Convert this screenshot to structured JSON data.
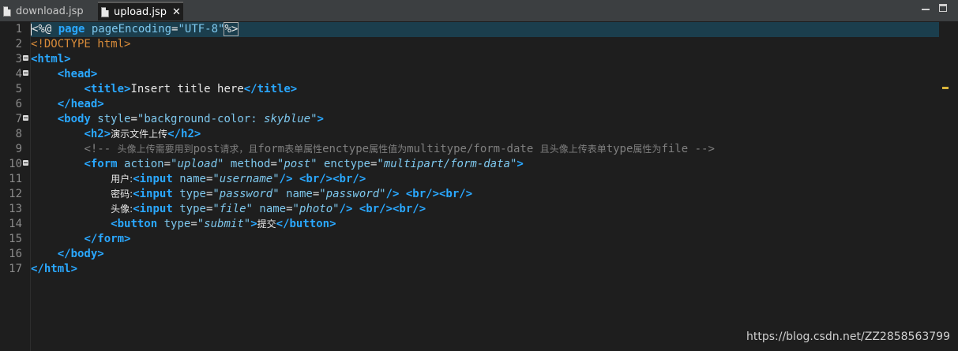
{
  "tabs": [
    {
      "label": "download.jsp",
      "active": false
    },
    {
      "label": "upload.jsp",
      "active": true
    }
  ],
  "close_glyph": "✕",
  "line_numbers": [
    "1",
    "2",
    "3",
    "4",
    "5",
    "6",
    "7",
    "8",
    "9",
    "10",
    "11",
    "12",
    "13",
    "14",
    "15",
    "16",
    "17"
  ],
  "code": {
    "l1": {
      "open": "<%@ ",
      "kw": "page",
      "attr": "pageEncoding",
      "eq": "=",
      "val": "\"UTF-8\"",
      "close": "%>"
    },
    "l2": {
      "text": "<!DOCTYPE html>"
    },
    "l3": {
      "tag": "<html>"
    },
    "l4": {
      "tag": "<head>"
    },
    "l5": {
      "open": "<title>",
      "text": "Insert title here",
      "close": "</title>"
    },
    "l6": {
      "tag": "</head>"
    },
    "l7": {
      "open": "<body ",
      "attr": "style",
      "eq": "=",
      "q1": "\"",
      "val": "background-color: ",
      "val2": "skyblue",
      "q2": "\"",
      "close": ">"
    },
    "l8": {
      "open": "<h2>",
      "text": "演示文件上传",
      "close": "</h2>"
    },
    "l9": {
      "c1": "<!-- ",
      "c2": "头像上传需要用到",
      "c3": "post",
      "c4": "请求，且",
      "c5": "form",
      "c6": "表单属性",
      "c7": "enctype",
      "c8": "属性值为",
      "c9": "multitype",
      "c10": "/form-date ",
      "c11": "且头像上传表单",
      "c12": "type",
      "c13": "属性为",
      "c14": "file -->"
    },
    "l10": {
      "open": "<form ",
      "a1": "action",
      "v1": "\"upload\"",
      "a2": "method",
      "v2": "\"post\"",
      "a3": "enctype",
      "v3": "\"multipart/form-data\"",
      "close": ">"
    },
    "l11": {
      "label": "用户:",
      "open": "<input ",
      "a1": "name",
      "v1": "\"username\"",
      "close": "/>",
      "br": "<br/><br/>"
    },
    "l12": {
      "label": "密码:",
      "open": "<input ",
      "a1": "type",
      "v1": "\"password\"",
      "a2": "name",
      "v2": "\"password\"",
      "close": "/>",
      "br": "<br/><br/>"
    },
    "l13": {
      "label": "头像:",
      "open": "<input ",
      "a1": "type",
      "v1": "\"file\"",
      "a2": "name",
      "v2": "\"photo\"",
      "close": "/>",
      "br": "<br/><br/>"
    },
    "l14": {
      "open": "<button ",
      "a1": "type",
      "v1": "\"submit\"",
      "gt": ">",
      "text": "提交",
      "close": "</button>"
    },
    "l15": {
      "tag": "</form>"
    },
    "l16": {
      "tag": "</body>"
    },
    "l17": {
      "tag": "</html>"
    }
  },
  "watermark": "https://blog.csdn.net/ZZ2858563799"
}
